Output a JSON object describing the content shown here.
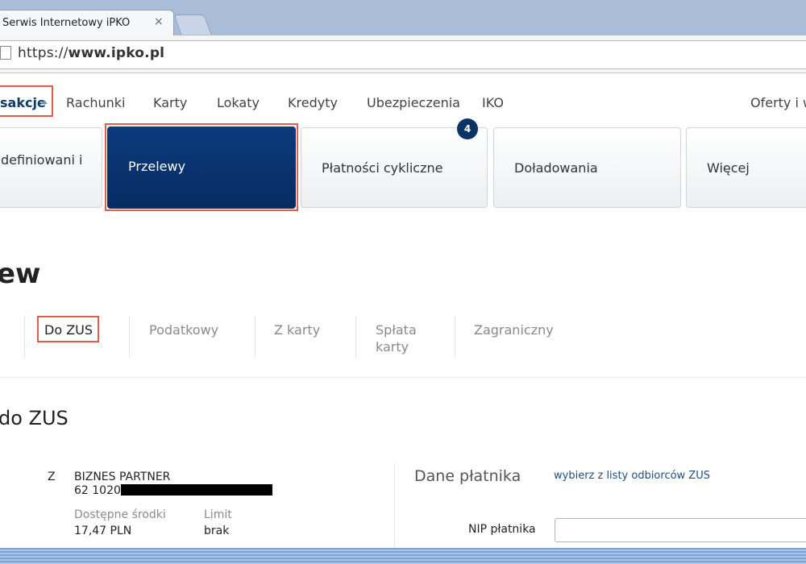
{
  "browser": {
    "tab_title": "Serwis Internetowy iPKO",
    "tab_close": "×",
    "url_prefix": "https://",
    "url_host": "www.ipko.pl"
  },
  "topnav": {
    "active": "sakcje",
    "items": [
      "Rachunki",
      "Karty",
      "Lokaty",
      "Kredyty",
      "Ubezpieczenia",
      "IKO",
      "Oferty i w"
    ]
  },
  "tiles": {
    "predefined": "definiowani i",
    "przelewy": "Przelewy",
    "cykliczne": "Płatności cykliczne",
    "cykliczne_badge": "4",
    "doladowania": "Doładowania",
    "wiecej": "Więcej"
  },
  "page": {
    "heading": "ew",
    "subtabs": [
      "Do ZUS",
      "Podatkowy",
      "Z karty",
      "Spłata",
      "karty",
      "Zagraniczny"
    ],
    "section_heading": "do ZUS"
  },
  "account": {
    "prefix": "Z",
    "name": "BIZNES PARTNER",
    "number": "62 1020",
    "available_label": "Dostępne środki",
    "available_value": "17,47 PLN",
    "limit_label": "Limit",
    "limit_value": "brak"
  },
  "payer": {
    "title": "Dane płatnika",
    "link": "wybierz z listy odbiorców ZUS",
    "nip_label": "NIP płatnika",
    "nip_value": ""
  },
  "colors": {
    "highlight": "#e35b4a",
    "brand_navy": "#062c62",
    "link": "#1a4e8a"
  }
}
